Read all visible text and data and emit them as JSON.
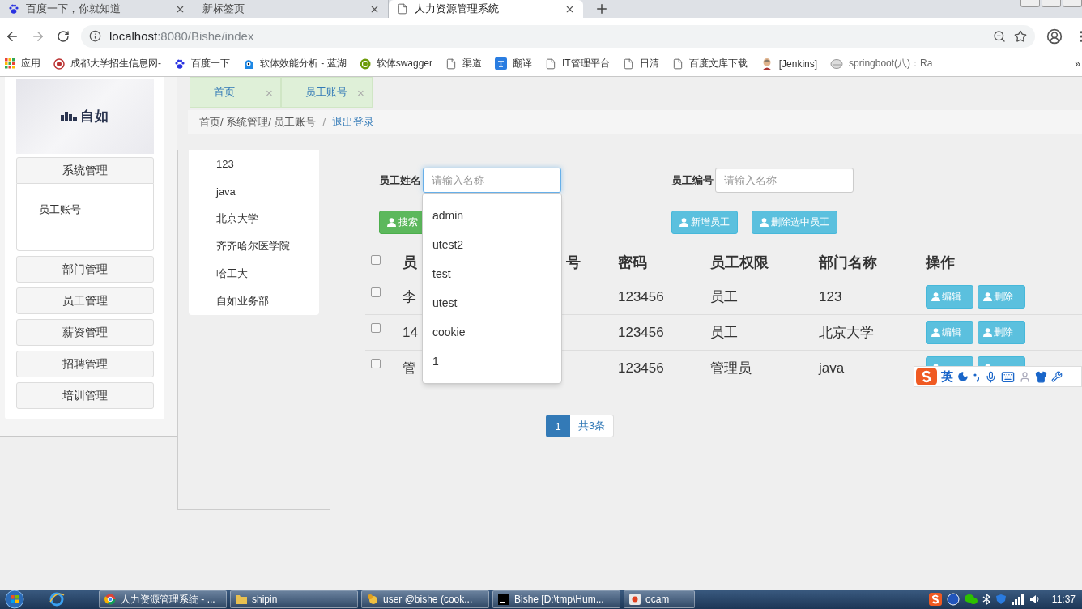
{
  "browser": {
    "tabs": [
      {
        "title": "百度一下，你就知道",
        "kind": "paw",
        "selected": false
      },
      {
        "title": "新标签页",
        "kind": "none",
        "selected": false
      },
      {
        "title": "人力资源管理系统",
        "kind": "page",
        "selected": true
      }
    ],
    "address": {
      "host": "localhost",
      "path": ":8080/Bishe/index"
    },
    "bookmarks": [
      {
        "label": "应用",
        "kind": "apps"
      },
      {
        "label": "成都大学招生信息网-",
        "kind": "seal"
      },
      {
        "label": "百度一下",
        "kind": "paw"
      },
      {
        "label": "软体效能分析 - 蓝湖",
        "kind": "monster"
      },
      {
        "label": "软体swagger",
        "kind": "swagger"
      },
      {
        "label": "渠道",
        "kind": "page"
      },
      {
        "label": "翻译",
        "kind": "translate"
      },
      {
        "label": "IT管理平台",
        "kind": "page"
      },
      {
        "label": "日清",
        "kind": "page"
      },
      {
        "label": "百度文库下载",
        "kind": "page"
      },
      {
        "label": "[Jenkins]",
        "kind": "figure"
      },
      {
        "label": "springboot(八)：Ra",
        "kind": "cloud"
      }
    ],
    "bookmarks_more": "»"
  },
  "sidebar": {
    "logo": "自如",
    "menu": [
      {
        "label": "系统管理",
        "expanded": true,
        "children": [
          {
            "label": "员工账号"
          }
        ]
      },
      {
        "label": "部门管理",
        "expanded": false
      },
      {
        "label": "员工管理",
        "expanded": false
      },
      {
        "label": "薪资管理",
        "expanded": false
      },
      {
        "label": "招聘管理",
        "expanded": false
      },
      {
        "label": "培训管理",
        "expanded": false
      }
    ]
  },
  "page_tabs": [
    {
      "label": "首页",
      "close": "×"
    },
    {
      "label": "员工账号",
      "close": "×"
    }
  ],
  "breadcrumb": {
    "path": "首页/ 系统管理/ 员工账号",
    "separator": "/",
    "logout": "退出登录"
  },
  "departments": [
    "123",
    "java",
    "北京大学",
    "齐齐哈尔医学院",
    "哈工大",
    "自如业务部"
  ],
  "search_form": {
    "fields": [
      {
        "label": "员工姓名",
        "placeholder": "请输入名称",
        "focused": true
      },
      {
        "label": "员工编号",
        "placeholder": "请输入名称",
        "focused": false
      }
    ],
    "buttons": [
      {
        "label": "搜索",
        "kind": "success"
      },
      {
        "label": "新增员工",
        "kind": "info"
      },
      {
        "label": "删除选中员工",
        "kind": "info"
      }
    ],
    "suggestions": [
      "admin",
      "utest2",
      "test",
      "utest",
      "cookie",
      "1"
    ]
  },
  "table": {
    "select_all": {
      "checked": false
    },
    "columns": [
      "员",
      "号",
      "密码",
      "员工权限",
      "部门名称",
      "操作"
    ],
    "rows": [
      {
        "checked": false,
        "name": "李",
        "password": "123456",
        "role": "员工",
        "department": "123",
        "actions": [
          {
            "label": "编辑"
          },
          {
            "label": "删除"
          }
        ]
      },
      {
        "checked": false,
        "name": "14",
        "password": "123456",
        "role": "员工",
        "department": "北京大学",
        "actions": [
          {
            "label": "编辑"
          },
          {
            "label": "删除"
          }
        ]
      },
      {
        "checked": false,
        "name": "管",
        "password": "123456",
        "role": "管理员",
        "department": "java",
        "actions": [
          {
            "covered": true
          },
          {
            "covered": true
          }
        ]
      }
    ]
  },
  "pagination": {
    "pages": [
      {
        "label": "1",
        "selected": true
      }
    ],
    "total": "共3条"
  },
  "ime": {
    "mode": "英"
  },
  "taskbar": {
    "tasks": [
      {
        "label": "人力资源管理系统 - ...",
        "kind": "chrome"
      },
      {
        "label": "shipin",
        "kind": "folder"
      },
      {
        "label": "user @bishe (cook...",
        "kind": "tool"
      },
      {
        "label": "Bishe [D:\\tmp\\Hum...",
        "kind": "ide"
      },
      {
        "label": "ocam",
        "kind": "recorder"
      }
    ],
    "clock": "11:37"
  }
}
